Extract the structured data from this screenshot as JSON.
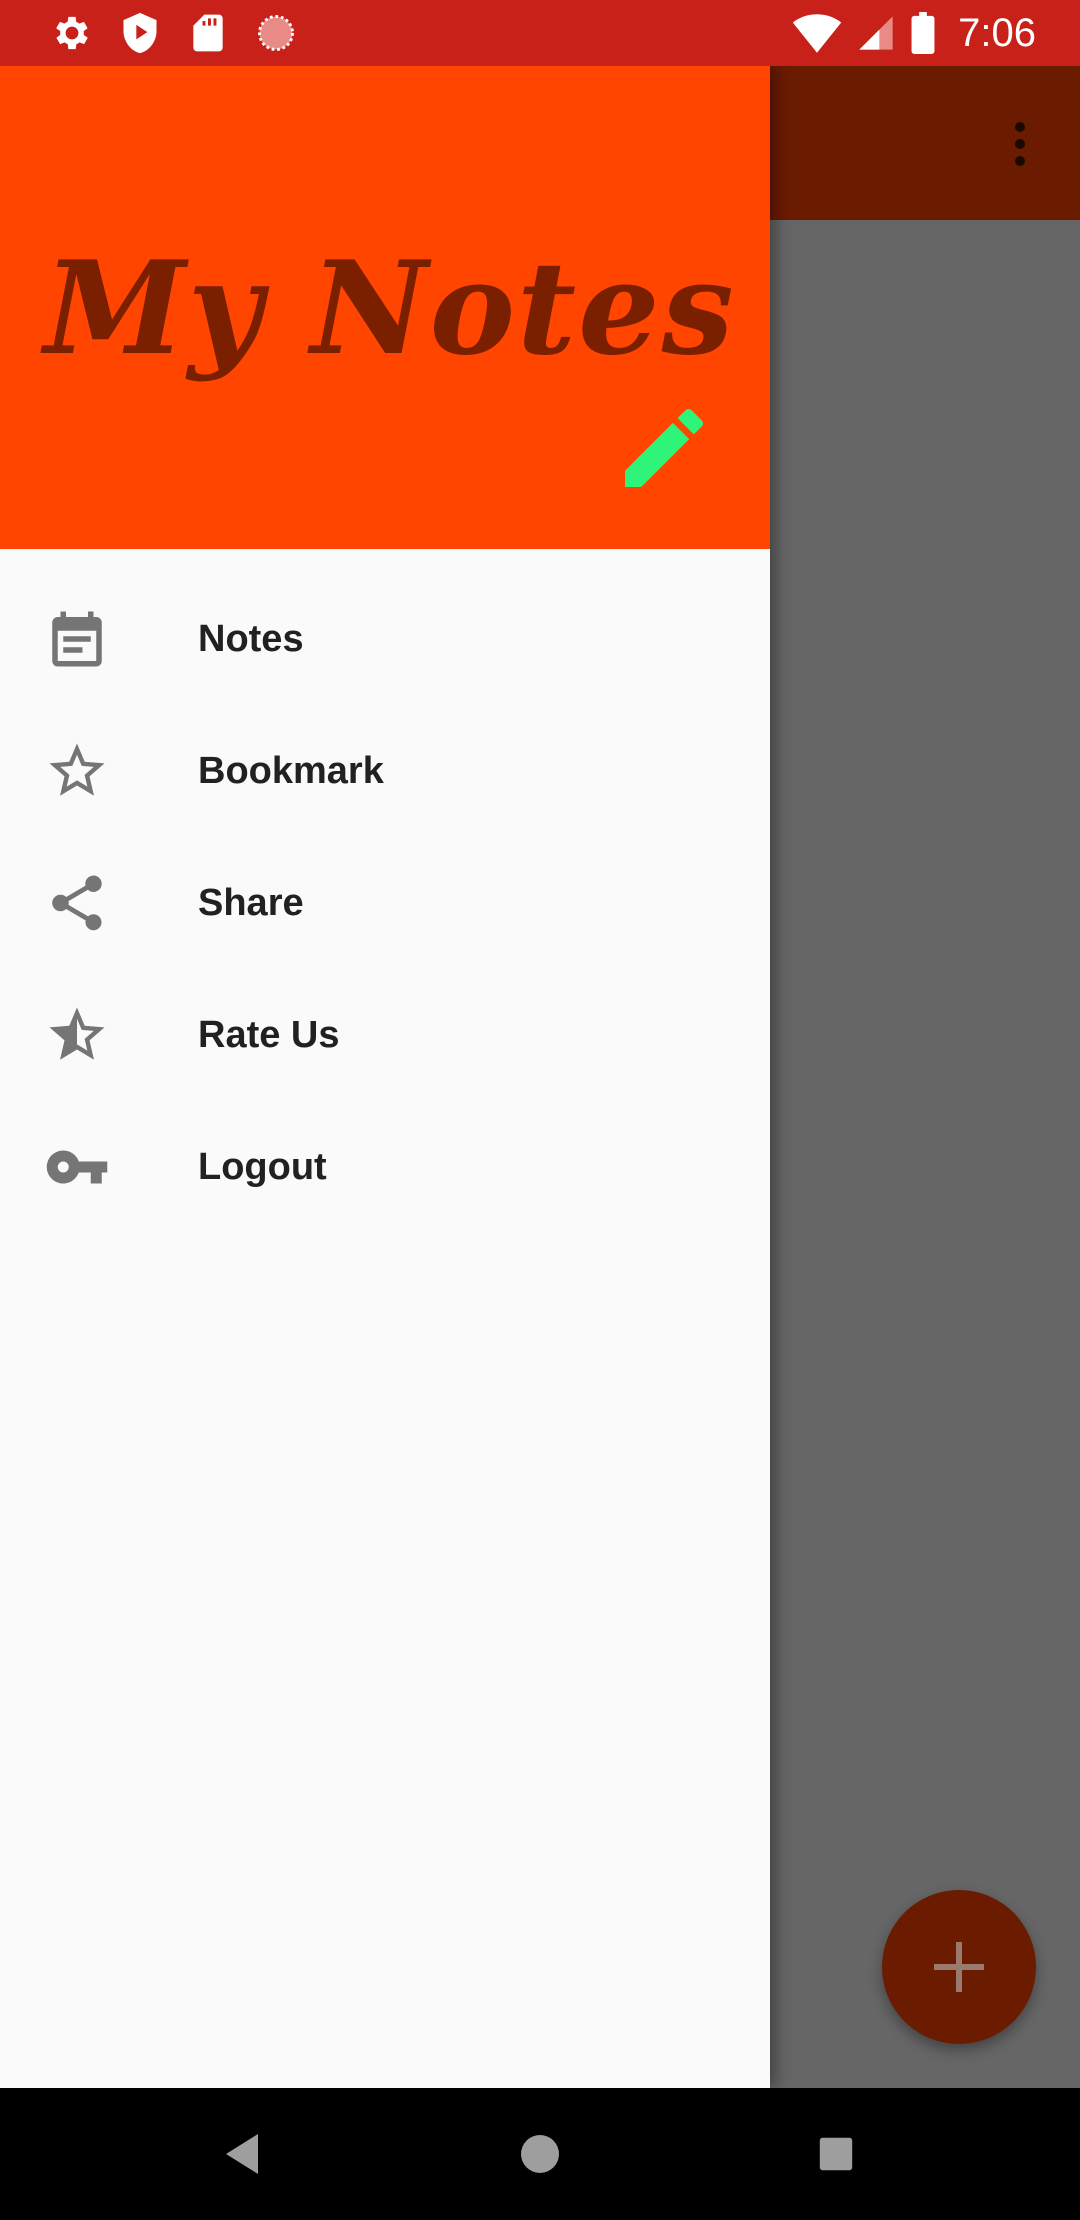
{
  "status_bar": {
    "time": "7:06",
    "left_icons": [
      "settings-icon",
      "shield-play-icon",
      "sd-card-icon",
      "loading-circle-icon"
    ],
    "right_icons": [
      "wifi-icon",
      "cell-signal-icon",
      "battery-icon"
    ],
    "background": "#C8211A"
  },
  "drawer": {
    "title": "My Notes",
    "header_color": "#FF4500",
    "title_color": "#7A1F00",
    "pencil_color": "#2EF57A",
    "items": [
      {
        "label": "Notes",
        "icon": "notes-calendar-icon"
      },
      {
        "label": "Bookmark",
        "icon": "star-outline-icon"
      },
      {
        "label": "Share",
        "icon": "share-icon"
      },
      {
        "label": "Rate Us",
        "icon": "star-half-icon"
      },
      {
        "label": "Logout",
        "icon": "key-icon"
      }
    ]
  },
  "app": {
    "toolbar_color": "#6B1B00",
    "fab_icon": "plus-icon"
  },
  "nav_bar": {
    "buttons": [
      "back-icon",
      "home-icon",
      "recents-icon"
    ]
  }
}
